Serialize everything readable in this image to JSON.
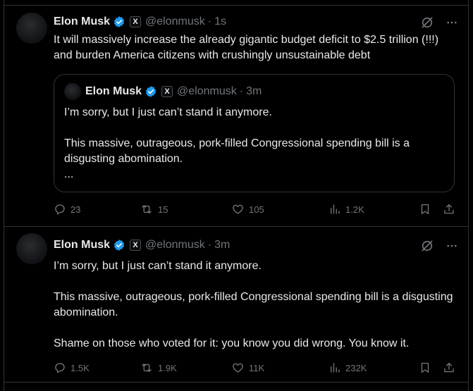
{
  "colors": {
    "background": "#000000",
    "text": "#e7e9ea",
    "muted": "#71767b",
    "border": "#2f3336",
    "verified_blue": "#1d9bf0"
  },
  "tweets": [
    {
      "author_name": "Elon Musk",
      "handle": "@elonmusk",
      "separator": "·",
      "time": "1s",
      "affiliate_badge": "X",
      "text": "It will massively increase the already gigantic budget deficit to $2.5 trillion (!!!) and burden America citizens with crushingly unsustainable debt",
      "quoted": {
        "author_name": "Elon Musk",
        "handle": "@elonmusk",
        "separator": "·",
        "time": "3m",
        "affiliate_badge": "X",
        "text": "I’m sorry, but I just can’t stand it anymore.\n\nThis massive, outrageous, pork-filled Congressional spending bill is a disgusting abomination.\n..."
      },
      "actions": {
        "replies": "23",
        "reposts": "15",
        "likes": "105",
        "views": "1.2K"
      }
    },
    {
      "author_name": "Elon Musk",
      "handle": "@elonmusk",
      "separator": "·",
      "time": "3m",
      "affiliate_badge": "X",
      "text": "I’m sorry, but I just can’t stand it anymore.\n\nThis massive, outrageous, pork-filled Congressional spending bill is a disgusting abomination.\n\nShame on those who voted for it: you know you did wrong. You know it.",
      "actions": {
        "replies": "1.5K",
        "reposts": "1.9K",
        "likes": "11K",
        "views": "232K"
      }
    }
  ],
  "icons": {
    "verified": "verified-badge-icon",
    "grok": "grok-icon",
    "more": "more-icon",
    "reply": "reply-icon",
    "repost": "repost-icon",
    "like": "heart-icon",
    "views": "views-icon",
    "bookmark": "bookmark-icon",
    "share": "share-icon"
  }
}
